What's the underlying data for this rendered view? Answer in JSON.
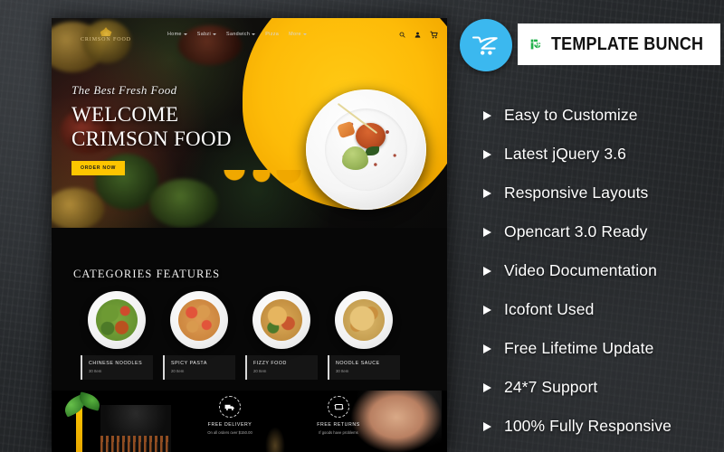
{
  "brand": {
    "opencart_icon": "opencart-cart-icon",
    "logo_icon": "template-bunch-mark-icon",
    "logo_text": "TEMPLATE BUNCH",
    "accent_green": "#22b24c",
    "accent_blue": "#3bb8ef",
    "accent_yellow": "#fdc500"
  },
  "features": [
    {
      "label": "Easy to Customize"
    },
    {
      "label": "Latest jQuery 3.6"
    },
    {
      "label": "Responsive Layouts"
    },
    {
      "label": "Opencart 3.0 Ready"
    },
    {
      "label": "Video Documentation"
    },
    {
      "label": "Icofont Used"
    },
    {
      "label": "Free Lifetime Update"
    },
    {
      "label": "24*7 Support"
    },
    {
      "label": "100% Fully Responsive"
    }
  ],
  "site": {
    "brand_name": "CRIMSON FOOD",
    "nav": [
      {
        "label": "Home",
        "caret": true
      },
      {
        "label": "Sabzi",
        "caret": true
      },
      {
        "label": "Sandwich",
        "caret": true
      },
      {
        "label": "Pizza",
        "caret": false
      },
      {
        "label": "More",
        "caret": true
      }
    ],
    "icons": {
      "search": "search-icon",
      "account": "user-icon",
      "cart": "shopping-cart-icon"
    },
    "hero": {
      "script": "The Best Fresh Food",
      "title_line1": "WELCOME",
      "title_line2": "CRIMSON FOOD",
      "button": "ORDER NOW"
    },
    "categories": {
      "heading": "CATEGORIES FEATURES",
      "items": [
        {
          "name": "CHINESE NOODLES",
          "count": "30 Item"
        },
        {
          "name": "SPICY PASTA",
          "count": "20 Item"
        },
        {
          "name": "FIZZY FOOD",
          "count": "20 Item"
        },
        {
          "name": "NOODLE SAUCE",
          "count": "30 Item"
        }
      ]
    },
    "services": [
      {
        "title": "FREE DELIVERY",
        "subtitle": "On all orders over $150.00",
        "icon": "delivery-truck-icon"
      },
      {
        "title": "FREE RETURNS",
        "subtitle": "If goods have problems",
        "icon": "return-arrows-icon"
      }
    ]
  }
}
